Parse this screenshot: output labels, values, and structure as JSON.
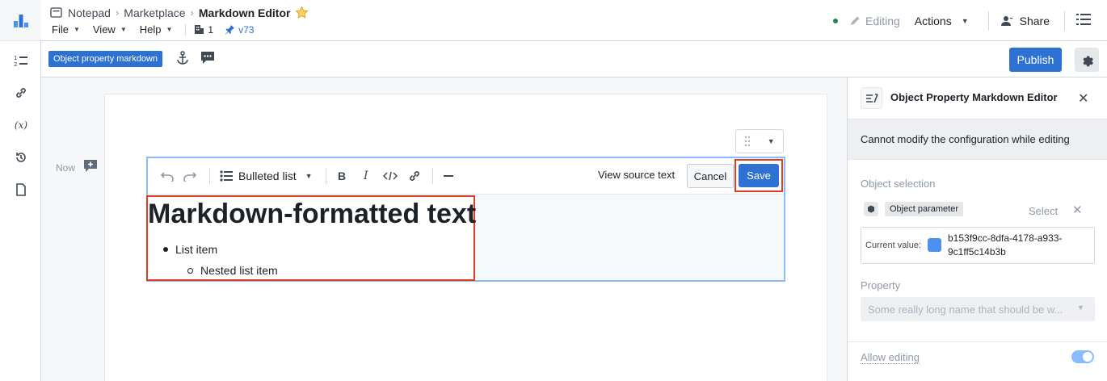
{
  "breadcrumb": {
    "items": [
      "Notepad",
      "Marketplace"
    ],
    "current": "Markdown Editor"
  },
  "menu": {
    "file": "File",
    "view": "View",
    "help": "Help",
    "count": "1",
    "version": "v73"
  },
  "header": {
    "editing": "Editing",
    "actions": "Actions",
    "share": "Share"
  },
  "toolbar": {
    "tag": "Object property markdown",
    "publish": "Publish"
  },
  "canvas": {
    "now": "Now"
  },
  "editor": {
    "list_style": "Bulleted list",
    "view_source": "View source text",
    "cancel": "Cancel",
    "save": "Save",
    "heading": "Markdown-formatted text",
    "list_item": "List item",
    "nested_item": "Nested list item"
  },
  "panel": {
    "title": "Object Property Markdown Editor",
    "note": "Cannot modify the configuration while editing",
    "object_selection": "Object selection",
    "object_parameter": "Object parameter",
    "select": "Select",
    "current_value_label": "Current value:",
    "current_value": "b153f9cc-8dfa-4178-a933-9c1ff5c14b3b",
    "property_label": "Property",
    "property_placeholder": "Some really long name that should be w...",
    "allow_editing": "Allow editing",
    "allow_editing_on": true
  },
  "colors": {
    "accent": "#2d72d2",
    "highlight": "#e03d20",
    "status_green": "#238551"
  }
}
